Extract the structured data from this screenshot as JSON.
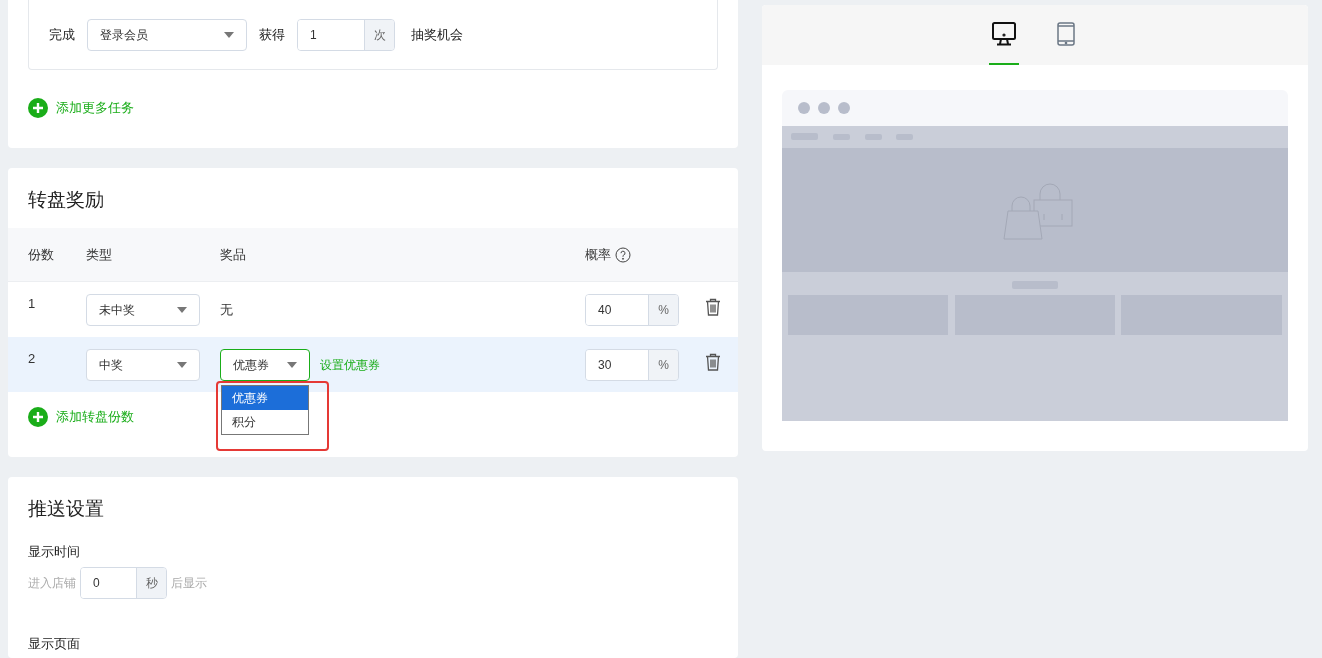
{
  "task_card": {
    "prefix": "完成",
    "task_select": "登录会员",
    "get_label": "获得",
    "count": "1",
    "count_unit": "次",
    "suffix": "抽奖机会",
    "add_link": "添加更多任务"
  },
  "rewards": {
    "title": "转盘奖励",
    "columns": [
      "份数",
      "类型",
      "奖品",
      "概率"
    ],
    "rows": [
      {
        "index": "1",
        "type": "未中奖",
        "prize": {
          "kind": "text",
          "text": "无"
        },
        "rate": "40",
        "unit": "%",
        "selected": false
      },
      {
        "index": "2",
        "type": "中奖",
        "prize": {
          "kind": "select",
          "value": "优惠券",
          "link": "设置优惠券",
          "open": true,
          "options": [
            {
              "label": "优惠券",
              "selected": true
            },
            {
              "label": "积分",
              "selected": false
            }
          ]
        },
        "rate": "30",
        "unit": "%",
        "selected": true
      }
    ],
    "add_link": "添加转盘份数"
  },
  "push": {
    "title": "推送设置",
    "time_label": "显示时间",
    "before": "进入店铺",
    "seconds": "0",
    "unit": "秒",
    "after": "后显示",
    "page_label": "显示页面"
  },
  "preview": {
    "tabs": [
      {
        "kind": "desktop",
        "selected": true
      },
      {
        "kind": "tablet",
        "selected": false
      }
    ]
  }
}
